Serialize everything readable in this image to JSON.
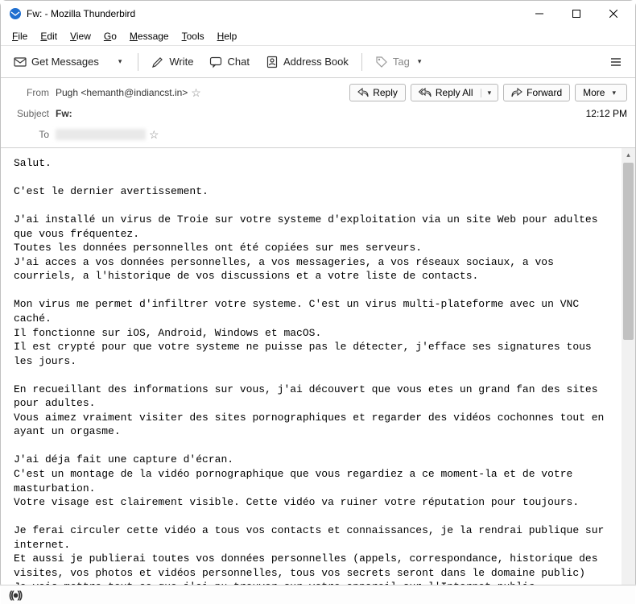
{
  "window": {
    "title": "Fw: - Mozilla Thunderbird"
  },
  "menu": {
    "file": "File",
    "edit": "Edit",
    "view": "View",
    "go": "Go",
    "message": "Message",
    "tools": "Tools",
    "help": "Help"
  },
  "toolbar": {
    "get_messages": "Get Messages",
    "write": "Write",
    "chat": "Chat",
    "address_book": "Address Book",
    "tag": "Tag"
  },
  "headers": {
    "from_label": "From",
    "from_value": "Pugh <hemanth@indiancst.in>",
    "subject_label": "Subject",
    "subject_value": "Fw:",
    "to_label": "To",
    "time": "12:12 PM"
  },
  "actions": {
    "reply": "Reply",
    "reply_all": "Reply All",
    "forward": "Forward",
    "more": "More"
  },
  "message_body": "Salut.\n\nC'est le dernier avertissement.\n\nJ'ai installé un virus de Troie sur votre systeme d'exploitation via un site Web pour adultes que vous fréquentez.\nToutes les données personnelles ont été copiées sur mes serveurs.\nJ'ai acces a vos données personnelles, a vos messageries, a vos réseaux sociaux, a vos courriels, a l'historique de vos discussions et a votre liste de contacts.\n\nMon virus me permet d'infiltrer votre systeme. C'est un virus multi-plateforme avec un VNC caché.\nIl fonctionne sur iOS, Android, Windows et macOS.\nIl est crypté pour que votre systeme ne puisse pas le détecter, j'efface ses signatures tous les jours.\n\nEn recueillant des informations sur vous, j'ai découvert que vous etes un grand fan des sites pour adultes.\nVous aimez vraiment visiter des sites pornographiques et regarder des vidéos cochonnes tout en ayant un orgasme.\n\nJ'ai déja fait une capture d'écran.\nC'est un montage de la vidéo pornographique que vous regardiez a ce moment-la et de votre masturbation.\nVotre visage est clairement visible. Cette vidéo va ruiner votre réputation pour toujours.\n\nJe ferai circuler cette vidéo a tous vos contacts et connaissances, je la rendrai publique sur internet.\nEt aussi je publierai toutes vos données personnelles (appels, correspondance, historique des visites, vos photos et vidéos personnelles, tous vos secrets seront dans le domaine public)\nJe vais mettre tout ce que j'ai pu trouver sur votre appareil sur l'Internet public.\n\nJe pense que vous savez ce que je veux dire.\nCela va etre un vrai désastre pour vous."
}
